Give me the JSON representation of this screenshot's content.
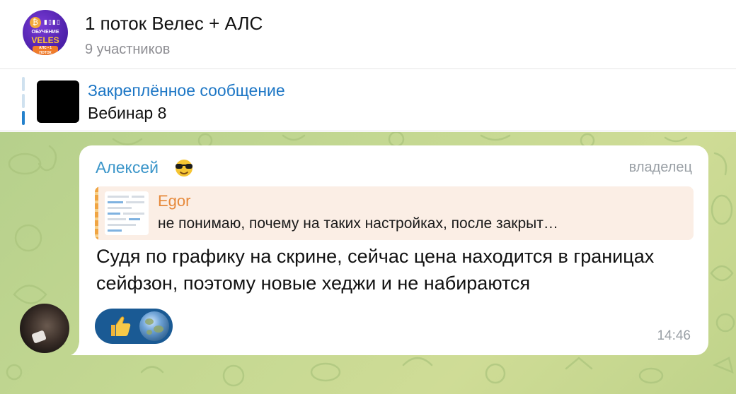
{
  "header": {
    "avatar": {
      "line1": "ОБУЧЕНИЕ",
      "line2": "VELES",
      "line3": "АЛС • 1 ПОТОК"
    },
    "title": "1 поток Велес + АЛС",
    "subtitle": "9 участников"
  },
  "pinned": {
    "label": "Закреплённое сообщение",
    "text": "Вебинар 8"
  },
  "message": {
    "sender_name": "Алексей",
    "sender_emoji": "sunglasses-emoji",
    "role": "владелец",
    "reply": {
      "author": "Egor",
      "text": "не понимаю, почему на таких настройках, после закрыт…"
    },
    "text": "Судя по графику на скрине, сейчас цена находится в границах сейфзон, поэтому новые хеджи и не набираются",
    "reactions": [
      "thumbs-up-emoji",
      "earth-globe-emoji"
    ],
    "time": "14:46"
  },
  "colors": {
    "accent_blue": "#1c76c5",
    "sender_name": "#3a95c9",
    "reply_author": "#e6893b",
    "reaction_bg": "#1a5a94",
    "chat_bg": "#c4d892"
  }
}
